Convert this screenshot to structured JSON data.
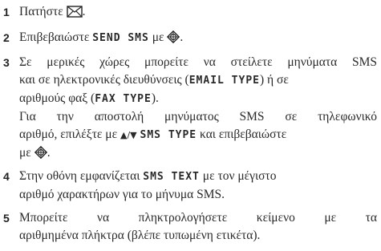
{
  "steps": [
    {
      "num": "1",
      "a": "Πατήστε",
      "b": "."
    },
    {
      "num": "2",
      "a": "Επιβεβαιώστε ",
      "lcd": "SEND SMS",
      "b": " με ",
      "c": "."
    },
    {
      "num": "3",
      "l1": "Σε μερικές χώρες μπορείτε να στείλετε μηνύματα SMS",
      "l2a": "και σε ηλεκτρονικές διευθύνσεις (",
      "lcd1": "EMAIL TYPE",
      "l2b": ") ή σε",
      "l3a": "αριθμούς φαξ (",
      "lcd2": "FAX TYPE",
      "l3b": ").",
      "l4": "Για την αποστολή μηνύματος SMS σε τηλεφωνικό",
      "l5a": "αριθμό, επιλέξτε με ",
      "arrows": "▲/▼",
      "lcd3": "SMS TYPE",
      "l5b": " και επιβεβαιώστε",
      "l6a": "με ",
      "l6b": "."
    },
    {
      "num": "4",
      "l1a": "Στην οθόνη εμφανίζεται ",
      "lcd": "SMS TEXT",
      "l1b": " με τον μέγιστο",
      "l2": "αριθμό χαρακτήρων για το μήνυμα SMS."
    },
    {
      "num": "5",
      "l1": "Μπορείτε να πληκτρολογήσετε κείμενο με τα",
      "l2": "αριθμημένα πλήκτρα (βλέπε τυπωμένη ετικέτα)."
    }
  ],
  "icons": {
    "sms": "envelope-icon",
    "confirm": "ok-nav-key-icon"
  }
}
